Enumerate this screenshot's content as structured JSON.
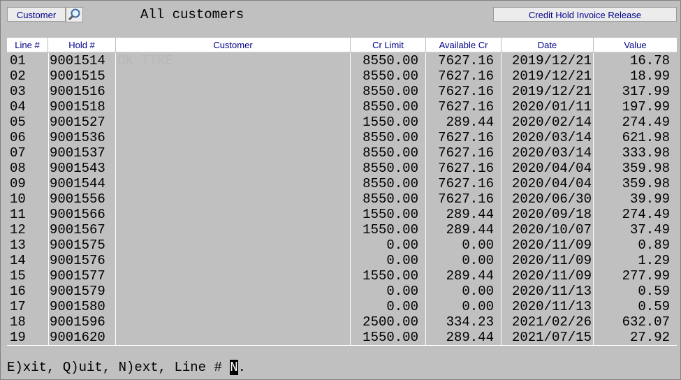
{
  "toolbar": {
    "customer_button": "Customer",
    "title": "All customers",
    "release_button": "Credit Hold Invoice Release"
  },
  "table": {
    "headers": [
      "Line #",
      "Hold #",
      "Customer",
      "Cr Limit",
      "Available Cr",
      "Date",
      "Value"
    ],
    "rows": [
      {
        "line": "01",
        "hold": "9001514",
        "customer": "OK TIRE",
        "cr": "8550.00",
        "avail": "7627.16",
        "date": "2019/12/21",
        "value": "16.78"
      },
      {
        "line": "02",
        "hold": "9001515",
        "customer": "",
        "cr": "8550.00",
        "avail": "7627.16",
        "date": "2019/12/21",
        "value": "18.99"
      },
      {
        "line": "03",
        "hold": "9001516",
        "customer": "",
        "cr": "8550.00",
        "avail": "7627.16",
        "date": "2019/12/21",
        "value": "317.99"
      },
      {
        "line": "04",
        "hold": "9001518",
        "customer": "",
        "cr": "8550.00",
        "avail": "7627.16",
        "date": "2020/01/11",
        "value": "197.99"
      },
      {
        "line": "05",
        "hold": "9001527",
        "customer": "",
        "cr": "1550.00",
        "avail": "289.44",
        "date": "2020/02/14",
        "value": "274.49"
      },
      {
        "line": "06",
        "hold": "9001536",
        "customer": "",
        "cr": "8550.00",
        "avail": "7627.16",
        "date": "2020/03/14",
        "value": "621.98"
      },
      {
        "line": "07",
        "hold": "9001537",
        "customer": "",
        "cr": "8550.00",
        "avail": "7627.16",
        "date": "2020/03/14",
        "value": "333.98"
      },
      {
        "line": "08",
        "hold": "9001543",
        "customer": "",
        "cr": "8550.00",
        "avail": "7627.16",
        "date": "2020/04/04",
        "value": "359.98"
      },
      {
        "line": "09",
        "hold": "9001544",
        "customer": "",
        "cr": "8550.00",
        "avail": "7627.16",
        "date": "2020/04/04",
        "value": "359.98"
      },
      {
        "line": "10",
        "hold": "9001556",
        "customer": "",
        "cr": "8550.00",
        "avail": "7627.16",
        "date": "2020/06/30",
        "value": "39.99"
      },
      {
        "line": "11",
        "hold": "9001566",
        "customer": "",
        "cr": "1550.00",
        "avail": "289.44",
        "date": "2020/09/18",
        "value": "274.49"
      },
      {
        "line": "12",
        "hold": "9001567",
        "customer": "",
        "cr": "1550.00",
        "avail": "289.44",
        "date": "2020/10/07",
        "value": "37.49"
      },
      {
        "line": "13",
        "hold": "9001575",
        "customer": "",
        "cr": "0.00",
        "avail": "0.00",
        "date": "2020/11/09",
        "value": "0.89"
      },
      {
        "line": "14",
        "hold": "9001576",
        "customer": "",
        "cr": "0.00",
        "avail": "0.00",
        "date": "2020/11/09",
        "value": "1.29"
      },
      {
        "line": "15",
        "hold": "9001577",
        "customer": "",
        "cr": "1550.00",
        "avail": "289.44",
        "date": "2020/11/09",
        "value": "277.99"
      },
      {
        "line": "16",
        "hold": "9001579",
        "customer": "",
        "cr": "0.00",
        "avail": "0.00",
        "date": "2020/11/13",
        "value": "0.59"
      },
      {
        "line": "17",
        "hold": "9001580",
        "customer": "",
        "cr": "0.00",
        "avail": "0.00",
        "date": "2020/11/13",
        "value": "0.59"
      },
      {
        "line": "18",
        "hold": "9001596",
        "customer": "",
        "cr": "2500.00",
        "avail": "334.23",
        "date": "2021/02/26",
        "value": "632.07"
      },
      {
        "line": "19",
        "hold": "9001620",
        "customer": "",
        "cr": "1550.00",
        "avail": "289.44",
        "date": "2021/07/15",
        "value": "27.92"
      }
    ]
  },
  "prompt": {
    "text": "E)xit, Q)uit, N)ext, Line # ",
    "cursor_value": "N",
    "suffix": "."
  }
}
